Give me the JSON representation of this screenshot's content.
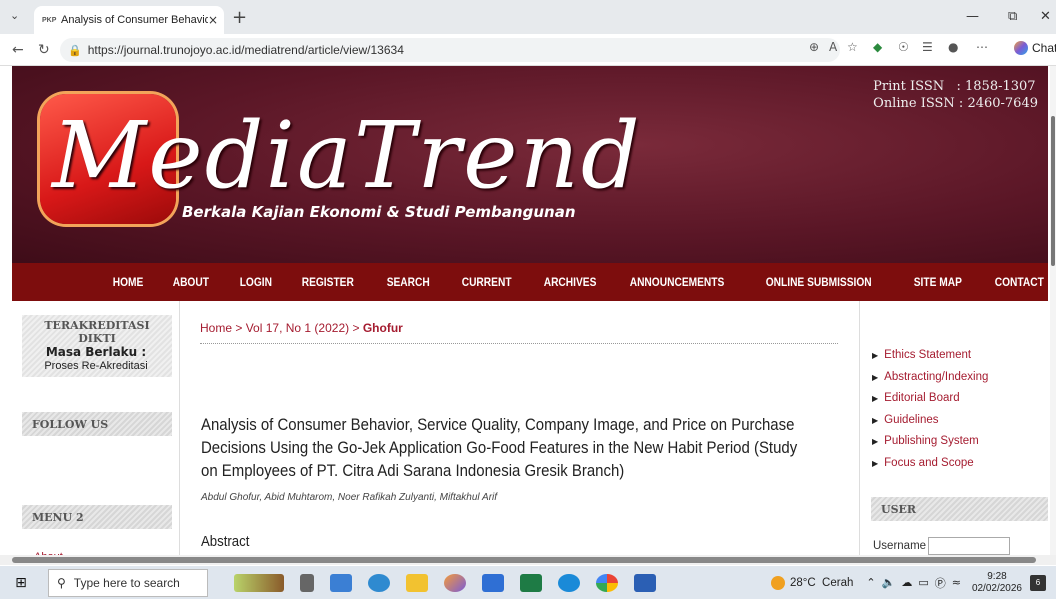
{
  "browser": {
    "tab_favicon": "PKP",
    "tab_title": "Analysis of Consumer Behavior, Se",
    "tab_close": "×",
    "new_tab": "+",
    "url": "https://journal.trunojoyo.ac.id/mediatrend/article/view/13634",
    "chat_label": "Chat"
  },
  "banner": {
    "logo_text": "MediaTrend",
    "tagline": "Berkala Kajian Ekonomi & Studi Pembangunan",
    "issn_print": "Print ISSN   : 1858-1307",
    "issn_online": "Online ISSN : 2460-7649"
  },
  "menu": [
    "HOME",
    "ABOUT",
    "LOGIN",
    "REGISTER",
    "SEARCH",
    "CURRENT",
    "ARCHIVES",
    "ANNOUNCEMENTS",
    "ONLINE SUBMISSION",
    "SITE MAP",
    "CONTACT"
  ],
  "left_sidebar": {
    "accred_heading": "TERAKREDITASI DIKTI",
    "masa_label": "Masa Berlaku :",
    "masa_value": "Proses Re-Akreditasi",
    "follow_heading": "FOLLOW US",
    "menu2_heading": "MENU 2",
    "partial_item": "About"
  },
  "main": {
    "breadcrumb_home": "Home",
    "breadcrumb_sep": ">",
    "breadcrumb_issue": "Vol 17, No 1 (2022)",
    "breadcrumb_current": "Ghofur",
    "title": "Analysis of Consumer Behavior, Service Quality, Company Image, and Price on Purchase Decisions Using the Go-Jek Application Go-Food Features in the New Habit Period (Study on Employees of PT. Citra Adi Sarana Indonesia Gresik Branch)",
    "authors": "Abdul Ghofur, Abid Muhtarom, Noer Rafikah Zulyanti, Miftakhul Arif",
    "abstract_heading": "Abstract"
  },
  "right_sidebar": {
    "links": [
      "Ethics Statement",
      "Abstracting/Indexing",
      "Editorial Board",
      "Guidelines",
      "Publishing System",
      "Focus and Scope"
    ],
    "user_heading": "USER",
    "username_label": "Username"
  },
  "taskbar": {
    "search_placeholder": "Type here to search",
    "weather": "28°C  Cerah",
    "time": "9:28",
    "date": "02/02/2026",
    "notification_count": "6"
  },
  "colors": {
    "menu_bg": "#7d0d0d",
    "link": "#a51c30",
    "banner_bg": "#5a1626"
  }
}
